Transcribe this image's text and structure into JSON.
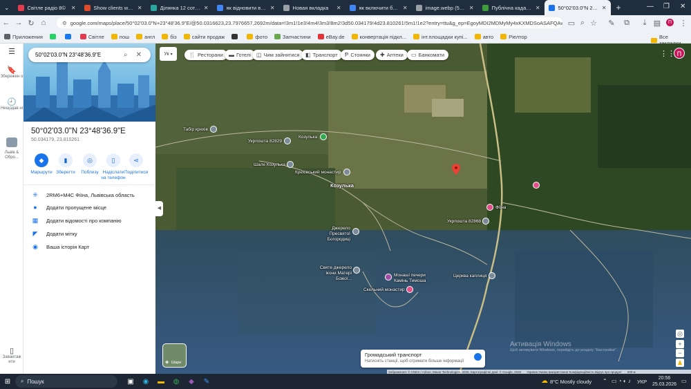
{
  "browser": {
    "tabs": [
      {
        "title": "Світле радіо 8©",
        "active": false,
        "color": "#e5394d"
      },
      {
        "title": "Show clients what yo",
        "active": false,
        "color": "#e24a2c"
      },
      {
        "title": "Ділянка 12 соток с.",
        "active": false,
        "color": "#2aa6a0"
      },
      {
        "title": "як відновити вкладк",
        "active": false,
        "color": "#4285f4"
      },
      {
        "title": "Новая вкладка",
        "active": false,
        "color": "#9aa0a6"
      },
      {
        "title": "як включити блютус",
        "active": false,
        "color": "#4285f4"
      },
      {
        "title": "image.webp (562×9",
        "active": false,
        "color": "#9aa0a6"
      },
      {
        "title": "Публічна кадастров",
        "active": false,
        "color": "#3e9d3a"
      },
      {
        "title": "50°02'03.0\"N 23°48'",
        "active": true,
        "color": "#1a73e8"
      }
    ],
    "url": "google.com/maps/place/50°02'03.0\"N+23°48'36.9\"E/@50.0316623,23.7976657,2692m/data=!3m1!1e3!4m4!3m3!8m2!3d50.034179!4d23.810261!5m1!1e2?entry=ttu&g_ep=EgoyMDI2MDMyMy4xKXMDSoASAFQAw%3D%3D",
    "bookmarks": [
      {
        "label": "Приложения",
        "color": "#5f6368"
      },
      {
        "label": "",
        "color": "#25d366"
      },
      {
        "label": "",
        "color": "#1877f2"
      },
      {
        "label": "Світле",
        "color": "#e5394d"
      },
      {
        "label": "пош",
        "color": "#f2b600"
      },
      {
        "label": "англ",
        "color": "#f2b600"
      },
      {
        "label": "біз",
        "color": "#f2b600"
      },
      {
        "label": "сайти продаж",
        "color": "#f2b600"
      },
      {
        "label": "",
        "color": "#333333"
      },
      {
        "label": "фото",
        "color": "#f2b600"
      },
      {
        "label": "Запчастини",
        "color": "#6aa84f"
      },
      {
        "label": "eBay.de",
        "color": "#e53238"
      },
      {
        "label": "конвертація підкл...",
        "color": "#f2b600"
      },
      {
        "label": "інт.площадки купі...",
        "color": "#f2b600"
      },
      {
        "label": "авто",
        "color": "#f2b600"
      },
      {
        "label": "Ріелтор",
        "color": "#f2b600"
      }
    ],
    "all_bookmarks": "Все закладки"
  },
  "rail": {
    "saved": "Збережен о",
    "recent": "Нещодав ні",
    "history_item": "Львів & Обро...",
    "install": "Завантаж ити"
  },
  "panel": {
    "search_value": "50°02'03.0\"N 23°48'36.9\"E",
    "title": "50°02'03.0\"N 23°48'36.9\"E",
    "coords": "50.034179, 23.810261",
    "actions": [
      {
        "label": "Маршрути",
        "icon": "directions-icon"
      },
      {
        "label": "Зберегти",
        "icon": "bookmark-icon"
      },
      {
        "label": "Поблизу",
        "icon": "nearby-icon"
      },
      {
        "label": "Надіслати на телефон",
        "icon": "phone-icon"
      },
      {
        "label": "Поділитися",
        "icon": "share-icon"
      }
    ],
    "info": [
      {
        "text": "2RM6+M4C Фіїна, Львівська область",
        "icon": "plus-code-icon"
      },
      {
        "text": "Додати пропущене місце",
        "icon": "add-place-icon"
      },
      {
        "text": "Додати відомості про компанію",
        "icon": "business-icon"
      },
      {
        "text": "Додати мітку",
        "icon": "label-icon"
      },
      {
        "text": "Ваша історія Карт",
        "icon": "history-icon"
      }
    ]
  },
  "map": {
    "layer_short": "Ук",
    "chips": [
      {
        "label": "Ресторани",
        "icon": "restaurant-icon"
      },
      {
        "label": "Готелі",
        "icon": "hotel-icon"
      },
      {
        "label": "Чим зайнятися",
        "icon": "activity-icon"
      },
      {
        "label": "Транспорт",
        "icon": "transit-icon"
      },
      {
        "label": "Стоянки",
        "icon": "parking-icon"
      },
      {
        "label": "Аптеки",
        "icon": "pharmacy-icon"
      },
      {
        "label": "Банкомати",
        "icon": "atm-icon"
      }
    ],
    "labels": {
      "tabir": "Табір крехів",
      "post1": "Укрпошта 82829",
      "kozulka_pin": "Козулька",
      "shale": "Шале Козулька",
      "monastery": "Крехівський монастир",
      "kozulka": "Козулька",
      "dzherelo": "Джерело Пресвятої Богородиці",
      "sviate": "Святе джерело ікони Матері Божої...",
      "pechery": "Монаші печери Камінь Тимоша",
      "skelnyi": "Скельний монастир",
      "tserkva": "Церква каплиця",
      "post2": "Укрпошта 82868",
      "fiina": "Фіїна"
    },
    "transit_title": "Громадський транспорт",
    "transit_sub": "Натисніть станції, щоб отримати більше інформації",
    "layers_label": "Шари",
    "windows_line1": "Активація Windows",
    "windows_line2": "Щоб активувати Windows, перейдіть до розділу \"Настройки\".",
    "attribution": "Зображення: © CNES / Airbus, Maxar Technologies, 2026, Картографічні дані: © Google, 2026",
    "footer_links": "Україна   Умови використання   Конфіденційність   Відгук про продукт",
    "scale": "200 м"
  },
  "taskbar": {
    "search": "Пошук",
    "weather": "8°C  Mostly cloudy",
    "lang": "УКР",
    "time": "20:56",
    "date": "25.03.2026"
  }
}
